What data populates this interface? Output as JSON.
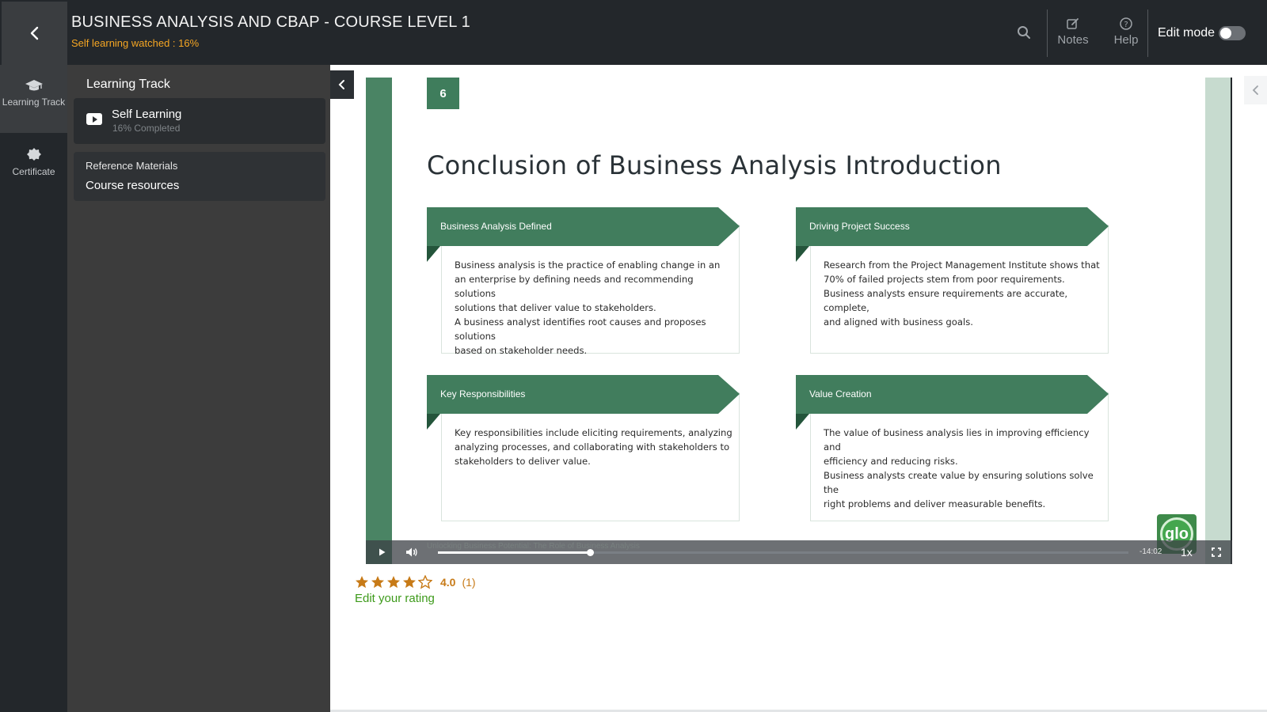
{
  "header": {
    "course_title": "BUSINESS ANALYSIS AND CBAP - COURSE LEVEL 1",
    "watched_text": "Self learning watched : 16%",
    "notes_label": "Notes",
    "help_label": "Help",
    "edit_mode_label": "Edit mode",
    "edit_mode_on": false,
    "icons": [
      "chevron-left-icon",
      "search-icon",
      "edit-icon",
      "help-icon"
    ]
  },
  "rail": {
    "items": [
      {
        "label": "Learning Track",
        "icon": "graduation-cap-icon",
        "active": true
      },
      {
        "label": "Certificate",
        "icon": "badge-icon",
        "active": false
      }
    ]
  },
  "panel": {
    "title": "Learning Track",
    "track": {
      "name": "Self Learning",
      "progress": "16% Completed"
    },
    "reference": {
      "label": "Reference Materials",
      "link": "Course resources"
    }
  },
  "slide": {
    "number": "6",
    "title": "Conclusion of Business Analysis Introduction",
    "cards": [
      {
        "heading": "Business Analysis Defined",
        "lines": [
          "Business analysis is the practice of enabling change in an",
          "an enterprise by defining needs and recommending solutions",
          "solutions that deliver value to stakeholders.",
          "A business analyst identifies root causes and proposes solutions",
          "based on stakeholder needs."
        ]
      },
      {
        "heading": "Driving Project Success",
        "lines": [
          "Research from the Project Management Institute shows that",
          "70% of failed projects stem from poor requirements.",
          "Business analysts ensure requirements are accurate, complete,",
          "and aligned with business goals."
        ]
      },
      {
        "heading": "Key Responsibilities",
        "lines": [
          "Key responsibilities include eliciting requirements, analyzing",
          "analyzing processes, and collaborating with stakeholders to",
          "stakeholders to deliver value."
        ]
      },
      {
        "heading": "Value Creation",
        "lines": [
          "The value of business analysis lies in improving efficiency and",
          "efficiency and reducing risks.",
          "Business analysts create value by ensuring solutions solve the",
          "right problems and deliver measurable benefits."
        ]
      }
    ],
    "logo_text": "glo",
    "footer_text": "Unlocking Business Potential: The Role of Business Analysis"
  },
  "player": {
    "time_remaining": "-14:02",
    "speed": "1x",
    "progress_fraction": 0.22
  },
  "rating": {
    "value": "4.0",
    "count": "(1)",
    "stars_filled": 4,
    "stars_total": 5,
    "edit_label": "Edit your rating"
  },
  "colors": {
    "header_bg": "#23272b",
    "panel_bg": "#3c3c3c",
    "slide_green": "#417d5d",
    "watched_orange": "#f5a623",
    "rating_orange": "#c77a17",
    "link_green": "#3d9a1a"
  }
}
